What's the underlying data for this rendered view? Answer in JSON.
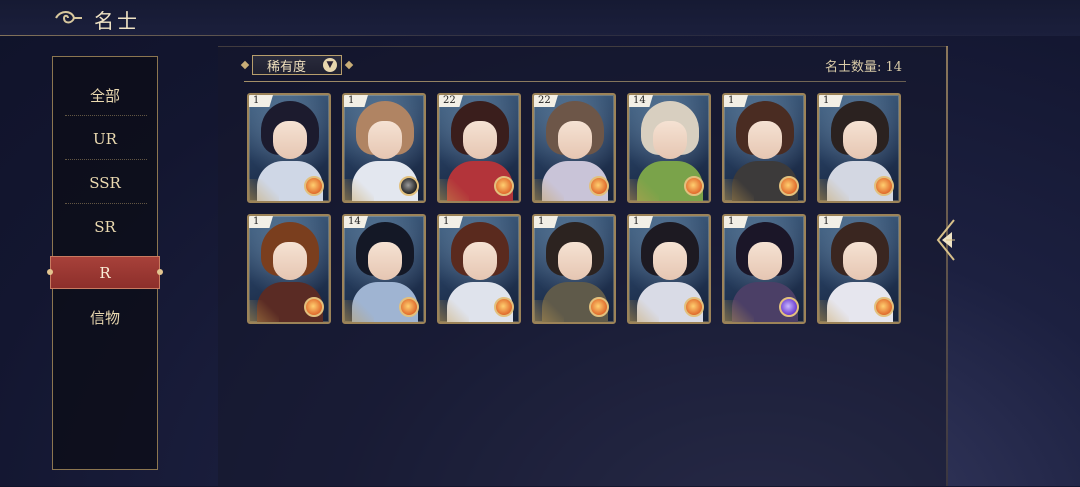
{
  "header": {
    "title": "名士"
  },
  "sidebar": {
    "items": [
      {
        "label": "全部",
        "active": false
      },
      {
        "label": "UR",
        "active": false
      },
      {
        "label": "SSR",
        "active": false
      },
      {
        "label": "SR",
        "active": false
      },
      {
        "label": "R",
        "active": true
      },
      {
        "label": "信物",
        "active": false
      }
    ]
  },
  "filter": {
    "label": "稀有度"
  },
  "count_text": "名士数量: 14",
  "cards": [
    {
      "level": "1",
      "hair": "#1c1b2e",
      "body": "#cfd7e6",
      "emblem": "orange"
    },
    {
      "level": "1",
      "hair": "#b08463",
      "body": "#e3e7ef",
      "emblem": "dark"
    },
    {
      "level": "22",
      "hair": "#3a1e1c",
      "body": "#b3343a",
      "emblem": "orange"
    },
    {
      "level": "22",
      "hair": "#6d5648",
      "body": "#c9c4d8",
      "emblem": "orange"
    },
    {
      "level": "14",
      "hair": "#d8cfc0",
      "body": "#7aa34a",
      "emblem": "orange"
    },
    {
      "level": "1",
      "hair": "#4a2c22",
      "body": "#3c3a3a",
      "emblem": "orange"
    },
    {
      "level": "1",
      "hair": "#2b2220",
      "body": "#d3d7e2",
      "emblem": "orange"
    },
    {
      "level": "1",
      "hair": "#7a3e1e",
      "body": "#5a2b24",
      "emblem": "orange"
    },
    {
      "level": "14",
      "hair": "#141826",
      "body": "#9fb4d2",
      "emblem": "orange"
    },
    {
      "level": "1",
      "hair": "#5a2a1e",
      "body": "#dfe3ec",
      "emblem": "orange"
    },
    {
      "level": "1",
      "hair": "#2c2320",
      "body": "#5f5a4a",
      "emblem": "orange"
    },
    {
      "level": "1",
      "hair": "#1d1a22",
      "body": "#d9dbe6",
      "emblem": "orange"
    },
    {
      "level": "1",
      "hair": "#1b1628",
      "body": "#4b3f66",
      "emblem": "purple"
    },
    {
      "level": "1",
      "hair": "#3a2620",
      "body": "#e6e6ee",
      "emblem": "orange"
    }
  ]
}
